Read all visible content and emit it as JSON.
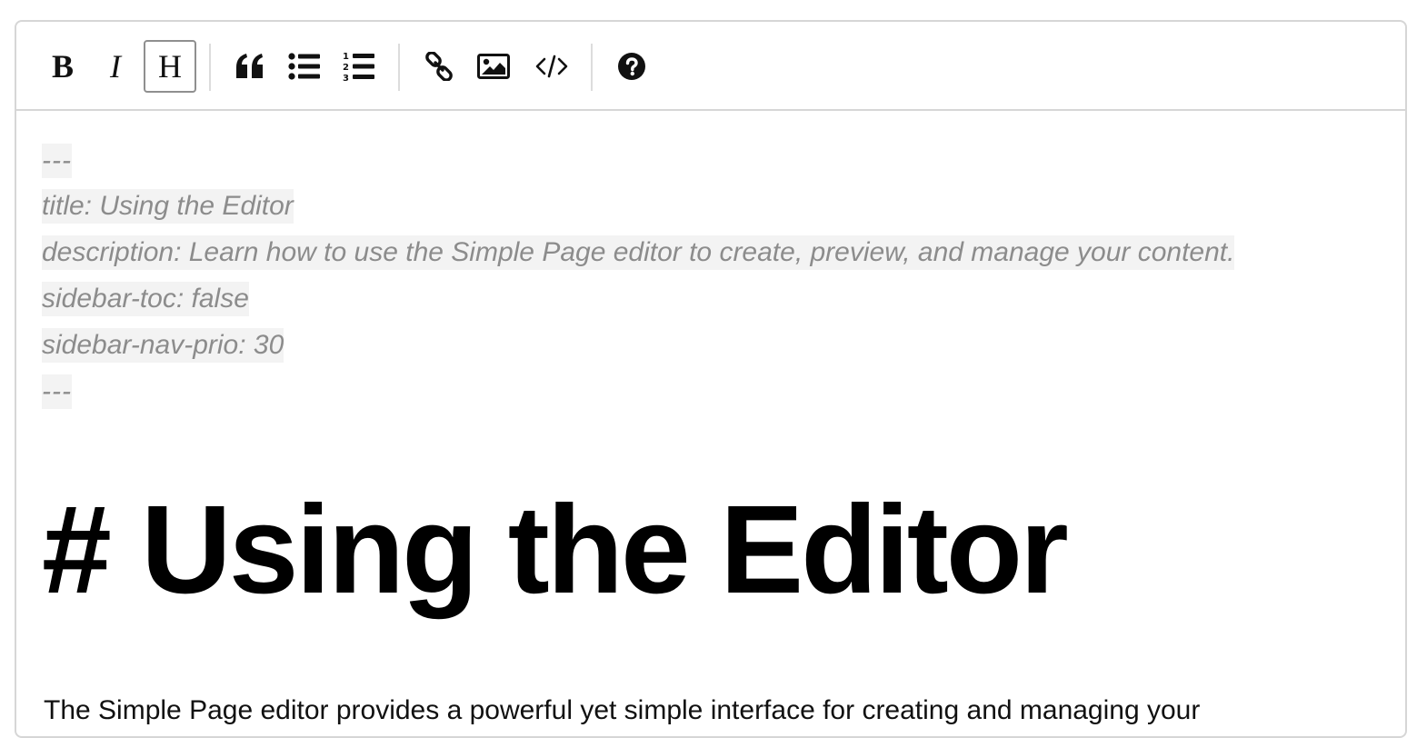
{
  "toolbar": {
    "bold": {
      "label": "B",
      "icon": "bold-icon"
    },
    "italic": {
      "label": "I",
      "icon": "italic-icon"
    },
    "heading": {
      "label": "H",
      "icon": "heading-icon",
      "active": true
    },
    "quote": {
      "icon": "quote-icon"
    },
    "unordered_list": {
      "icon": "unordered-list-icon"
    },
    "ordered_list": {
      "icon": "ordered-list-icon"
    },
    "link": {
      "icon": "link-icon"
    },
    "image": {
      "icon": "image-icon"
    },
    "code": {
      "icon": "code-icon"
    },
    "help": {
      "icon": "help-icon"
    }
  },
  "editor": {
    "front_matter": [
      "---",
      "title: Using the Editor",
      "description: Learn how to use the Simple Page editor to create, preview, and manage your content.",
      "sidebar-toc: false",
      "sidebar-nav-prio: 30",
      "---"
    ],
    "heading": "# Using the Editor",
    "paragraph": "The Simple Page editor provides a powerful yet simple interface for creating and managing your"
  },
  "colors": {
    "border": "#d6d6d6",
    "front_matter_text": "#8c8c8c",
    "front_matter_bg": "#f3f3f3",
    "active_button_border": "#8f8f8f"
  }
}
